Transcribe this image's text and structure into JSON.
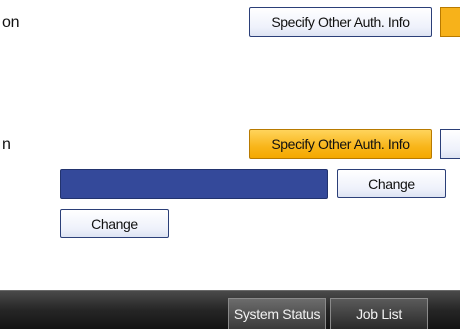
{
  "rows": {
    "row1_fragment": "on",
    "row1_button": "Specify Other Auth. Info",
    "row2_fragment": "n",
    "row2_button": "Specify Other Auth. Info",
    "change_primary": "Change",
    "change_secondary": "Change"
  },
  "status_bar": {
    "system_status": "System Status",
    "job_list": "Job List"
  },
  "colors": {
    "selected": "#f8b51a",
    "field": "#34499a",
    "bar": "#262626"
  }
}
